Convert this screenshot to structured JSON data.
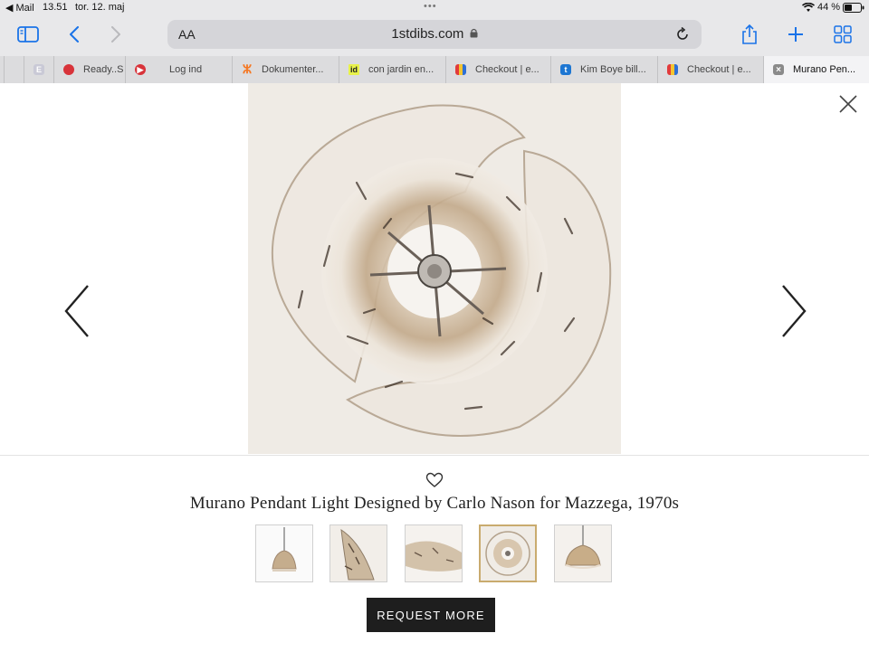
{
  "status_bar": {
    "back_app": "◀ Mail",
    "time": "13.51",
    "date": "tor. 12. maj",
    "battery": "44 %"
  },
  "toolbar": {
    "text_size_label": "AA",
    "url": "1stdibs.com"
  },
  "tabs": [
    {
      "label": "",
      "icon": "E"
    },
    {
      "label": "Ready..S",
      "icon": "red-circle"
    },
    {
      "label": "Log ind",
      "icon": "red-play"
    },
    {
      "label": "Dokumenter...",
      "icon": "hubspot"
    },
    {
      "label": "con jardin en...",
      "icon": "id"
    },
    {
      "label": "Checkout | e...",
      "icon": "multicolor"
    },
    {
      "label": "Kim Boye bill...",
      "icon": "t"
    },
    {
      "label": "Checkout | e...",
      "icon": "multicolor"
    },
    {
      "label": "Murano Pen...",
      "icon": "close"
    }
  ],
  "product": {
    "title": "Murano Pendant Light Designed by Carlo Nason for Mazzega, 1970s",
    "request_button": "REQUEST MORE",
    "selected_thumbnail": 4
  },
  "colors": {
    "accent": "#1a73e8",
    "selected_border": "#c9ab6e",
    "button_bg": "#1e1e1e"
  }
}
